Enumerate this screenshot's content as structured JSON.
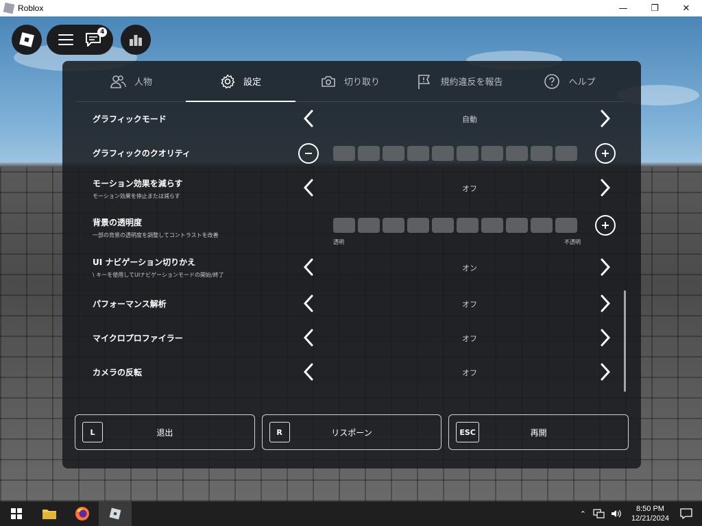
{
  "window": {
    "title": "Roblox",
    "minimize": "—",
    "maximize": "❐",
    "close": "✕"
  },
  "overlay": {
    "chat_badge": "4"
  },
  "tabs": [
    {
      "label": "人物",
      "icon": "people-icon",
      "active": false
    },
    {
      "label": "設定",
      "icon": "gear-icon",
      "active": true
    },
    {
      "label": "切り取り",
      "icon": "camera-icon",
      "active": false
    },
    {
      "label": "規約違反を報告",
      "icon": "flag-icon",
      "active": false
    },
    {
      "label": "ヘルプ",
      "icon": "help-icon",
      "active": false
    }
  ],
  "settings": {
    "graphics_mode": {
      "label": "グラフィックモード",
      "value": "自動"
    },
    "graphics_quality": {
      "label": "グラフィックのクオリティ",
      "level": 0,
      "segments": 10
    },
    "reduce_motion": {
      "label": "モーション効果を減らす",
      "desc": "モーション効果を停止または減らす",
      "value": "オフ"
    },
    "background_transparency": {
      "label": "背景の透明度",
      "desc": "一部の背景の透明度を調整してコントラストを改善",
      "min_label": "透明",
      "max_label": "不透明",
      "level": 0,
      "segments": 10
    },
    "ui_navigation": {
      "label": "UI ナビゲーション切りかえ",
      "desc": "\\ キーを使用してUIナビゲーションモードの開始/終了",
      "value": "オン"
    },
    "performance_stats": {
      "label": "パフォーマンス解析",
      "value": "オフ"
    },
    "micro_profiler": {
      "label": "マイクロプロファイラー",
      "value": "オフ"
    },
    "camera_inverted": {
      "label": "カメラの反転",
      "value": "オフ"
    }
  },
  "footer": [
    {
      "key": "L",
      "label": "退出"
    },
    {
      "key": "R",
      "label": "リスポーン"
    },
    {
      "key": "ESC",
      "label": "再開"
    }
  ],
  "taskbar": {
    "time": "8:50 PM",
    "date": "12/21/2024"
  },
  "colors": {
    "panel_bg": "#191b1e",
    "accent": "#ffffff",
    "segment": "#5c5f64"
  }
}
